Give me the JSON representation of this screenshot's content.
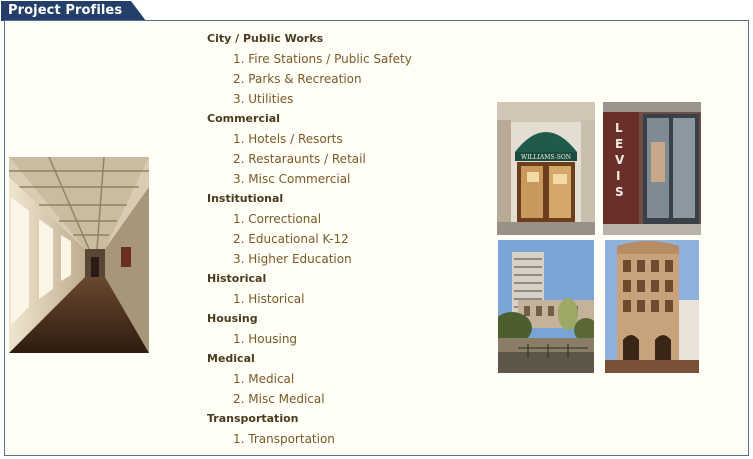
{
  "header": {
    "title": "Project Profiles"
  },
  "categories": [
    {
      "label": "City / Public Works",
      "items": [
        "1. Fire Stations / Public Safety",
        "2. Parks & Recreation",
        "3. Utilities"
      ]
    },
    {
      "label": "Commercial",
      "items": [
        "1. Hotels / Resorts",
        "2. Restaraunts / Retail",
        "3. Misc Commercial"
      ]
    },
    {
      "label": "Institutional",
      "items": [
        "1. Correctional",
        "2. Educational K-12",
        "3. Higher Education"
      ]
    },
    {
      "label": "Historical",
      "items": [
        "1. Historical"
      ]
    },
    {
      "label": "Housing",
      "items": [
        "1. Housing"
      ]
    },
    {
      "label": "Medical",
      "items": [
        "1. Medical",
        "2. Misc Medical"
      ]
    },
    {
      "label": "Transportation",
      "items": [
        "1. Transportation"
      ]
    }
  ],
  "photos": {
    "store1_sign": "WILLIAMS-SON",
    "store2_sign": "LEVI'S"
  }
}
